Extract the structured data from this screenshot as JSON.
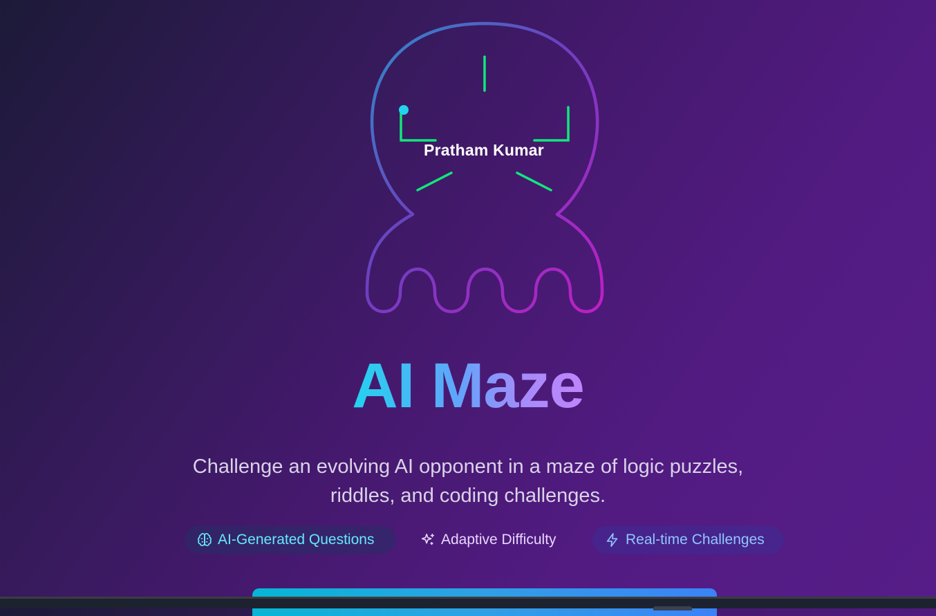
{
  "logo": {
    "name": "Pratham Kumar"
  },
  "hero": {
    "title": "AI Maze",
    "subtitle": "Challenge an evolving AI opponent in a maze of logic puzzles, riddles, and coding challenges."
  },
  "features": [
    {
      "label": "AI-Generated Questions",
      "icon": "brain-icon"
    },
    {
      "label": "Adaptive Difficulty",
      "icon": "sparkles-icon"
    },
    {
      "label": "Real-time Challenges",
      "icon": "zap-icon"
    }
  ],
  "colors": {
    "accent_cyan": "#22d3ee",
    "accent_blue": "#60a5fa",
    "accent_purple": "#c084fc",
    "circuit_green": "#10e87a",
    "background": "#45196e"
  }
}
